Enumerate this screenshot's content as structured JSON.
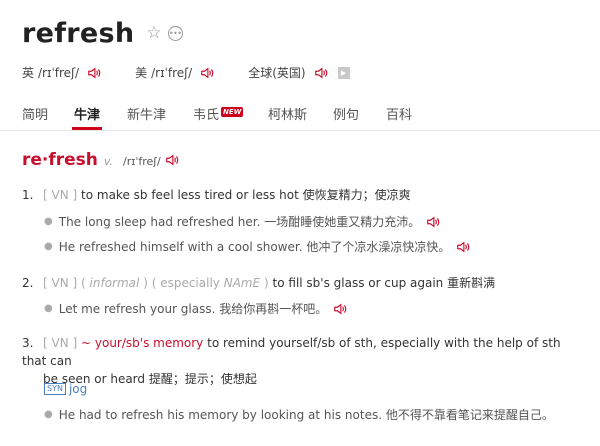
{
  "headword": "refresh",
  "header_icons": {
    "star": "star-outline-icon",
    "more": "more-options-icon"
  },
  "pronunciations": [
    {
      "region": "英",
      "ipa": "/rɪˈfreʃ/"
    },
    {
      "region": "美",
      "ipa": "/rɪˈfreʃ/"
    },
    {
      "region": "全球(英国)",
      "ipa": ""
    }
  ],
  "tabs": [
    {
      "label": "简明"
    },
    {
      "label": "牛津",
      "active": true
    },
    {
      "label": "新牛津"
    },
    {
      "label": "韦氏",
      "badge": "NEW"
    },
    {
      "label": "柯林斯"
    },
    {
      "label": "例句"
    },
    {
      "label": "百科"
    }
  ],
  "entry": {
    "word": "re·fresh",
    "pos": "v.",
    "ipa": "/rɪˈfreʃ/",
    "senses": [
      {
        "num": "1.",
        "grammar": "[ VN ]",
        "def": "to make sb feel less tired or less hot",
        "zh": "使恢复精力；使凉爽",
        "examples": [
          "The long sleep had refreshed her. 一场酣睡使她重又精力充沛。",
          "He refreshed himself with a cool shower. 他冲了个凉水澡凉快凉快。"
        ]
      },
      {
        "num": "2.",
        "grammar": "[ VN ]",
        "register_open": "(",
        "register": "informal",
        "register_close": ")",
        "especially_open": "( especially",
        "region": "NAmE",
        "especially_close": ")",
        "def": "to fill sb's glass or cup again",
        "zh": "重新斟满",
        "examples": [
          "Let me refresh your glass. 我给你再斟一杯吧。"
        ]
      },
      {
        "num": "3.",
        "grammar": "[ VN ]",
        "pattern": "~ your/sb's memory",
        "def_line1": "to remind yourself/sb of sth, especially with the help of sth that can",
        "def_line2": "be seen or heard",
        "zh": "提醒；提示；使想起",
        "syn_label": "SYN",
        "syn": "jog",
        "examples": [
          "He had to refresh his memory by looking at his notes. 他不得不靠看笔记来提醒自己。"
        ]
      }
    ]
  },
  "colors": {
    "accent": "#c8102e",
    "syn": "#4a7fc1",
    "muted": "#aaaaaa"
  }
}
